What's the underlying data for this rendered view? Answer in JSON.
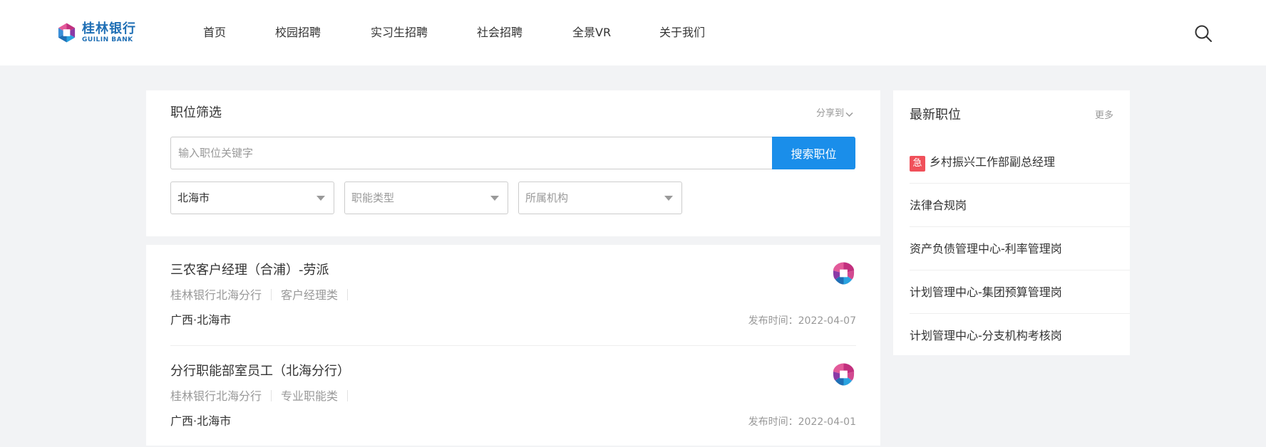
{
  "header": {
    "logo_cn": "桂林银行",
    "logo_en": "GUILIN BANK",
    "nav": [
      "首页",
      "校园招聘",
      "实习生招聘",
      "社会招聘",
      "全景VR",
      "关于我们"
    ]
  },
  "filter": {
    "title": "职位筛选",
    "share_label": "分享到",
    "search_placeholder": "输入职位关键字",
    "search_button": "搜索职位",
    "city": "北海市",
    "function_type": "职能类型",
    "organization": "所属机构"
  },
  "jobs": [
    {
      "title": "三农客户经理（合浦）-劳派",
      "org": "桂林银行北海分行",
      "category": "客户经理类",
      "location": "广西·北海市",
      "date": "发布时间：2022-04-07"
    },
    {
      "title": "分行职能部室员工（北海分行）",
      "org": "桂林银行北海分行",
      "category": "专业职能类",
      "location": "广西·北海市",
      "date": "发布时间：2022-04-01"
    }
  ],
  "latest": {
    "title": "最新职位",
    "more": "更多",
    "urgent_badge": "急",
    "items": [
      "乡村振兴工作部副总经理",
      "法律合规岗",
      "资产负债管理中心-利率管理岗",
      "计划管理中心-集团预算管理岗",
      "计划管理中心-分支机构考核岗"
    ]
  },
  "colors": {
    "accent": "#1a8eea",
    "brand": "#1f6fb5",
    "urgent": "#f0505a"
  }
}
